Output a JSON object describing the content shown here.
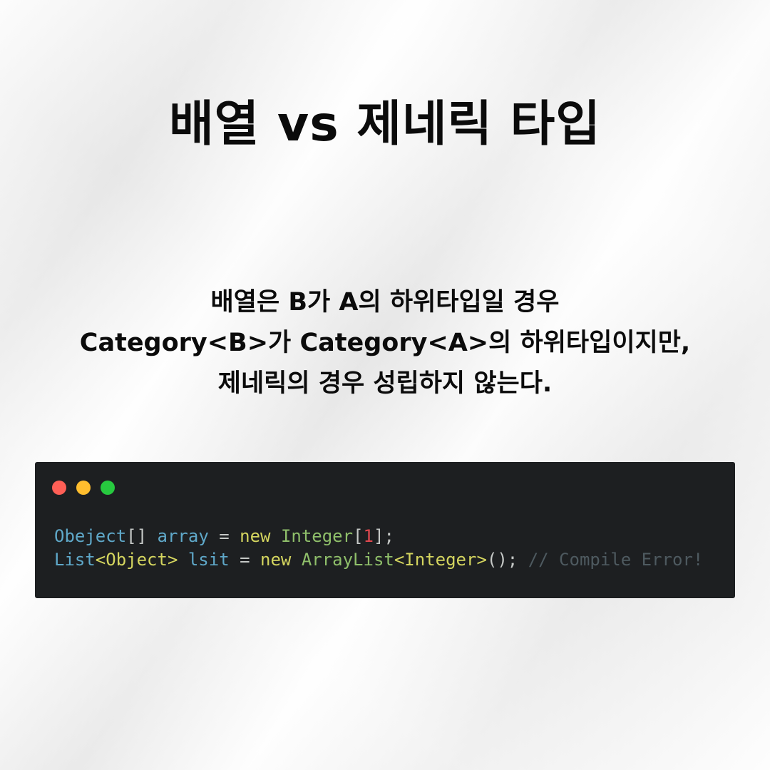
{
  "title": "배열 vs 제네릭 타입",
  "description": {
    "lines": [
      "배열은 B가 A의 하위타입일 경우",
      "Category<B>가  Category<A>의  하위타입이지만,",
      "제네릭의 경우 성립하지 않는다."
    ]
  },
  "code_window": {
    "dots": {
      "red": "#ff5f56",
      "yellow": "#ffbd2e",
      "green": "#27c93f"
    },
    "line1": {
      "type": "Obeject",
      "brackets": "[] ",
      "var": "array",
      "eq": " = ",
      "kw": "new",
      "space": " ",
      "cls": "Integer",
      "open": "[",
      "num": "1",
      "close": "];"
    },
    "line2": {
      "type": "List",
      "generic": "<Object>",
      "space1": " ",
      "var": "lsit",
      "eq": " = ",
      "kw": "new",
      "space2": " ",
      "cls": "ArrayList",
      "generic2": "<Integer>",
      "parens": "(); ",
      "comment": "// Compile Error!"
    }
  },
  "colors": {
    "background": "#f1f1f1",
    "code_bg": "#1d1f21",
    "type": "#5fa8c9",
    "keyword": "#d4d55f",
    "class": "#8fbf6a",
    "number": "#e0484f",
    "comment": "#4e5a60"
  }
}
